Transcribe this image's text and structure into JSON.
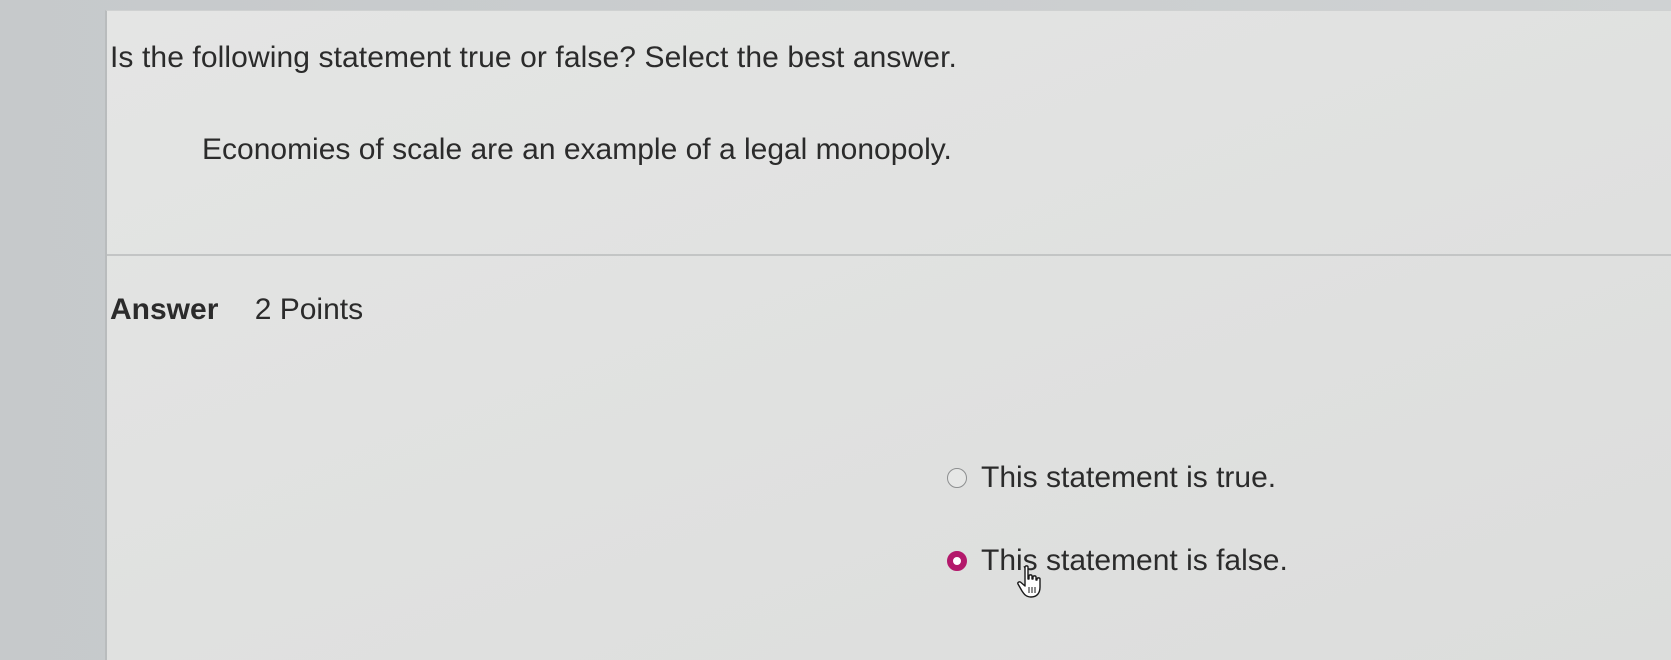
{
  "question": {
    "prompt": "Is the following statement true or false? Select the best answer.",
    "statement": "Economies of scale are an example of a legal monopoly."
  },
  "answer": {
    "label": "Answer",
    "points": "2 Points"
  },
  "options": [
    {
      "label": "This statement is true.",
      "selected": false
    },
    {
      "label": "This statement is false.",
      "selected": true
    }
  ],
  "colors": {
    "selected_radio": "#b3196b"
  },
  "icons": {
    "cursor": "hand-pointer-icon"
  }
}
